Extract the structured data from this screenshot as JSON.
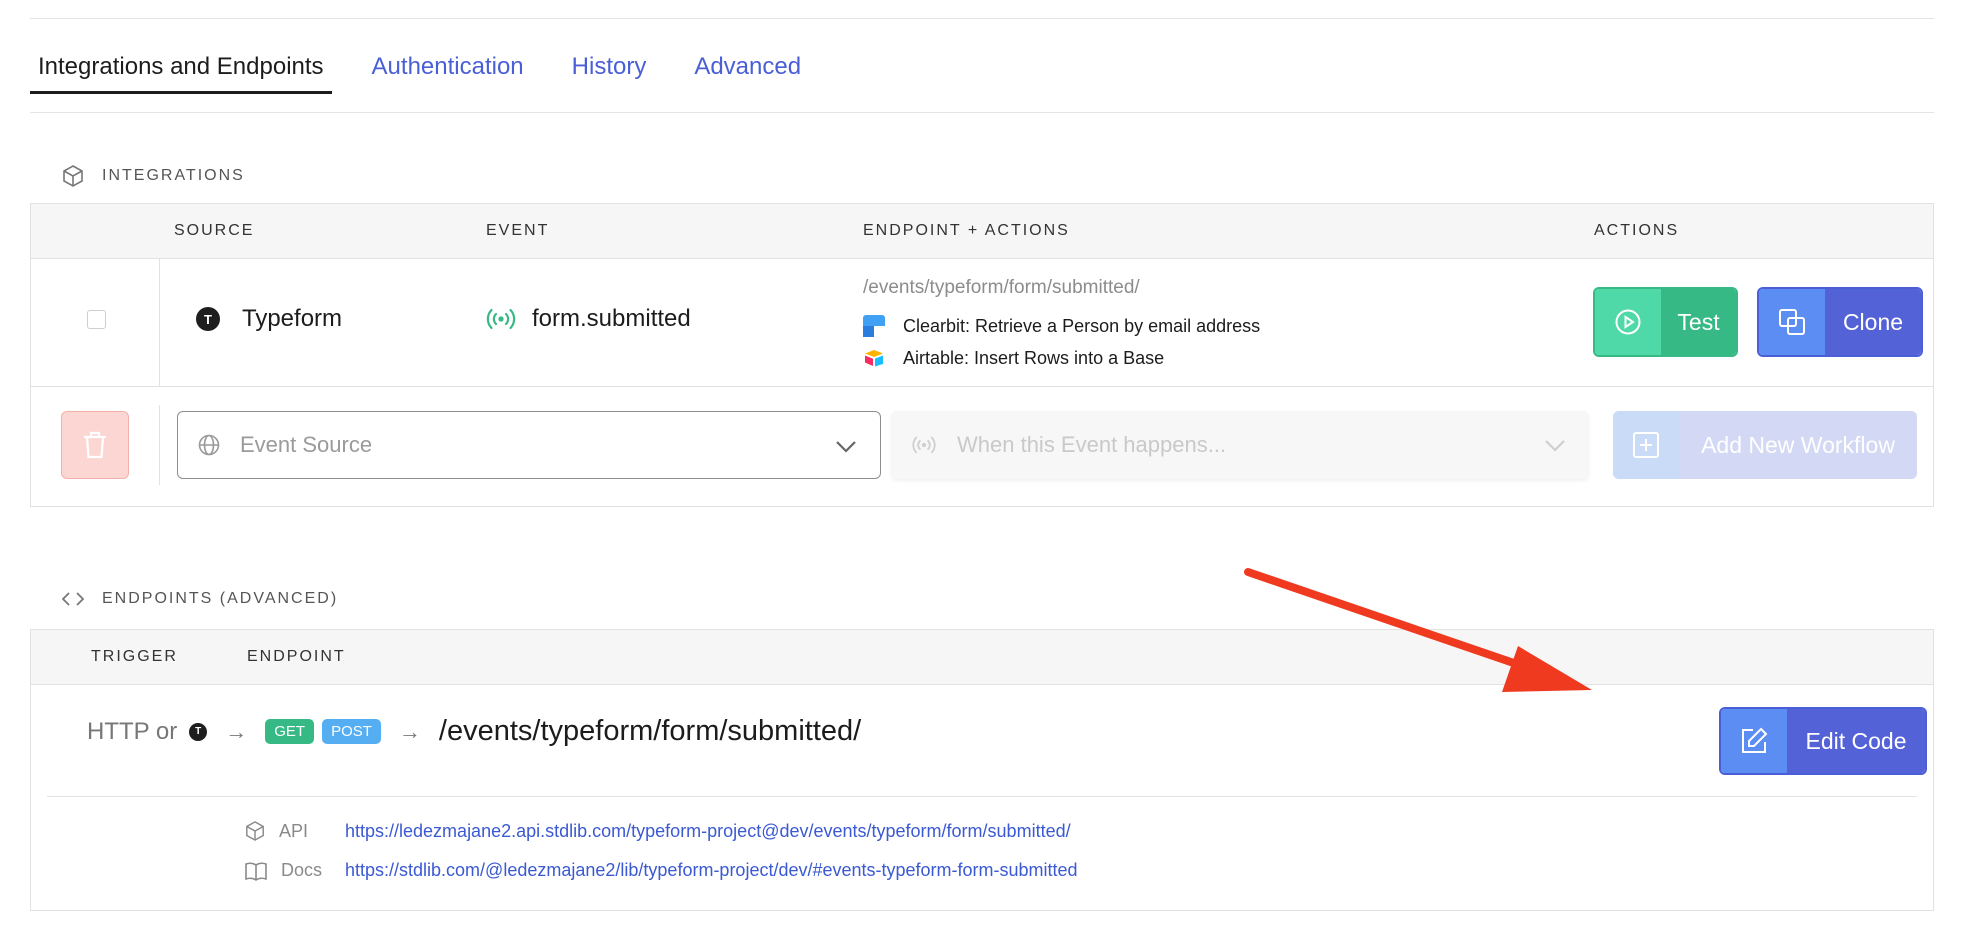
{
  "tabs": [
    {
      "label": "Integrations and Endpoints",
      "active": true
    },
    {
      "label": "Authentication",
      "active": false
    },
    {
      "label": "History",
      "active": false
    },
    {
      "label": "Advanced",
      "active": false
    }
  ],
  "integrations": {
    "title": "INTEGRATIONS",
    "columns": [
      "SOURCE",
      "EVENT",
      "ENDPOINT + ACTIONS",
      "ACTIONS"
    ],
    "row": {
      "source_badge": "T",
      "source": "Typeform",
      "event": "form.submitted",
      "endpoint_path": "/events/typeform/form/submitted/",
      "actions": [
        {
          "label": "Clearbit: Retrieve a Person by email address",
          "icon": "clearbit-icon"
        },
        {
          "label": "Airtable: Insert Rows into a Base",
          "icon": "airtable-icon"
        }
      ],
      "test_label": "Test",
      "clone_label": "Clone"
    },
    "new_row": {
      "source_placeholder": "Event Source",
      "event_placeholder": "When this Event happens...",
      "add_label": "Add New Workflow"
    }
  },
  "endpoints": {
    "title": "ENDPOINTS (ADVANCED)",
    "columns": [
      "TRIGGER",
      "ENDPOINT"
    ],
    "trigger_prefix": "HTTP or",
    "trigger_badge": "T",
    "methods": [
      "GET",
      "POST"
    ],
    "path": "/events/typeform/form/submitted/",
    "edit_label": "Edit Code",
    "links": [
      {
        "label": "API",
        "url": "https://ledezmajane2.api.stdlib.com/typeform-project@dev/events/typeform/form/submitted/"
      },
      {
        "label": "Docs",
        "url": "https://stdlib.com/@ledezmajane2/lib/typeform-project/dev/#events-typeform-form-submitted"
      }
    ]
  },
  "colors": {
    "accent_blue": "#5462d8",
    "accent_green": "#36b985",
    "link": "#3a59d3",
    "annotation_arrow": "#f03a1f"
  }
}
